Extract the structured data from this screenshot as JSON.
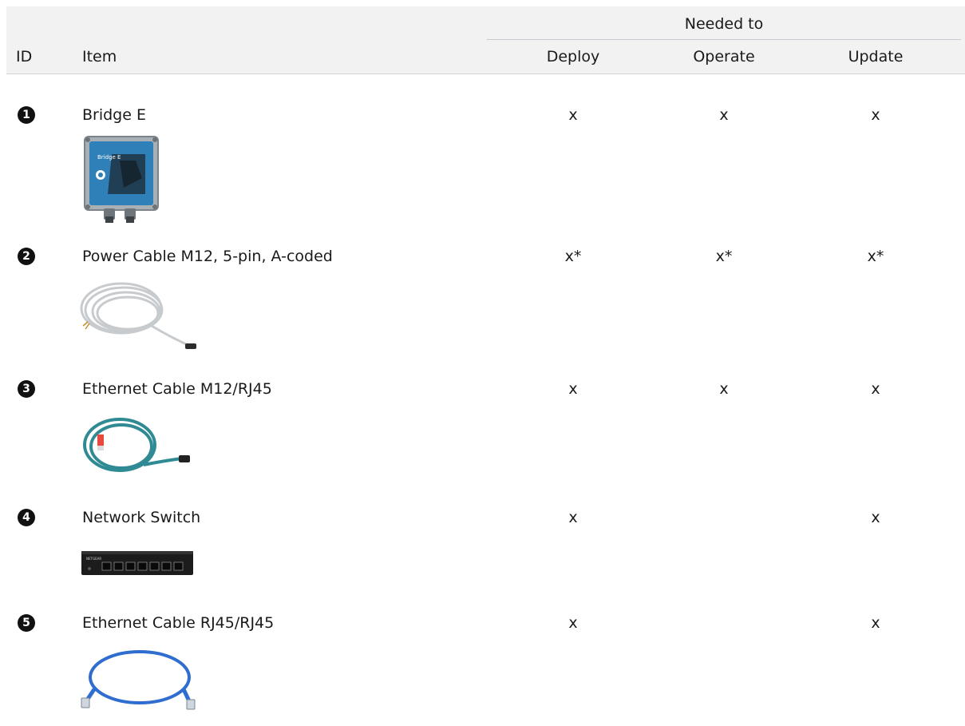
{
  "table": {
    "group_header": "Needed to",
    "columns": {
      "id": "ID",
      "item": "Item",
      "deploy": "Deploy",
      "operate": "Operate",
      "update": "Update"
    },
    "rows": [
      {
        "id": "1",
        "item": "Bridge E",
        "deploy": "x",
        "operate": "x",
        "update": "x",
        "image": "bridge-e-device-image"
      },
      {
        "id": "2",
        "item": "Power Cable M12, 5-pin, A-coded",
        "deploy": "x*",
        "operate": "x*",
        "update": "x*",
        "image": "power-cable-image"
      },
      {
        "id": "3",
        "item": "Ethernet Cable M12/RJ45",
        "deploy": "x",
        "operate": "x",
        "update": "x",
        "image": "ethernet-m12-cable-image"
      },
      {
        "id": "4",
        "item": "Network Switch",
        "deploy": "x",
        "operate": "",
        "update": "x",
        "image": "network-switch-image"
      },
      {
        "id": "5",
        "item": "Ethernet Cable RJ45/RJ45",
        "deploy": "x",
        "operate": "",
        "update": "x",
        "image": "ethernet-rj45-cable-image"
      }
    ]
  },
  "device_label": "Bridge E",
  "switch_brand": "NETGEAR",
  "colors": {
    "header_bg": "#f2f2f2",
    "badge": "#111111",
    "text": "#1a1a1a"
  }
}
